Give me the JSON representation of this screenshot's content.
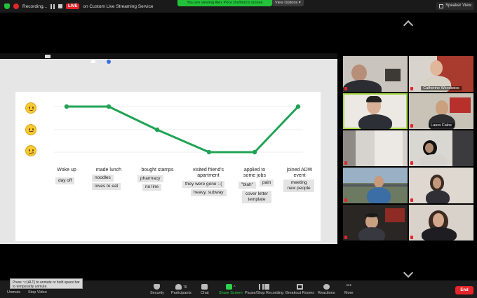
{
  "topbar": {
    "recording_label": "Recording...",
    "live_label": "LIVE",
    "stream_label": "on Custom Live Streaming Service",
    "viewing_label": "You are viewing Alex Price (he/him)'s screen",
    "view_options_label": "View Options",
    "speaker_view_label": "Speaker View"
  },
  "share_tabs": [
    "",
    "",
    "",
    ""
  ],
  "journey": {
    "stages": [
      {
        "label": "Woke up",
        "notes": [
          "day off"
        ]
      },
      {
        "label": "made lunch",
        "notes": [
          "noodles",
          "loves to eat"
        ]
      },
      {
        "label": "bought stamps",
        "notes": [
          "pharmacy",
          "no line"
        ]
      },
      {
        "label": "visited friend's apartment",
        "notes": [
          "they were gone :-(",
          "heavy, subway"
        ]
      },
      {
        "label": "applied to some jobs",
        "notes": [
          "\"blah\"",
          "pain",
          "cover letter template"
        ]
      },
      {
        "label": "joined ADW event",
        "notes": [
          "meeting new people"
        ]
      }
    ],
    "levels": [
      1,
      1,
      0,
      -1,
      -1,
      1
    ],
    "colors": {
      "line": "#1fa354",
      "grid": "#e6e6e6"
    }
  },
  "gallery": {
    "tiles": [
      {
        "name": ""
      },
      {
        "name": "Catherine Woodiwiss"
      },
      {
        "name": ""
      },
      {
        "name": "Laura Calos"
      },
      {
        "name": ""
      },
      {
        "name": ""
      },
      {
        "name": ""
      },
      {
        "name": ""
      },
      {
        "name": ""
      },
      {
        "name": ""
      }
    ]
  },
  "toolbar": {
    "unmute": "Unmute",
    "stop_video": "Stop Video",
    "security": "Security",
    "participants": "Participants",
    "participants_count": "76",
    "chat": "Chat",
    "share_screen": "Share Screen",
    "pause_recording": "Pause/Stop Recording",
    "breakout_rooms": "Breakout Rooms",
    "reactions": "Reactions",
    "more": "More",
    "end": "End",
    "tooltip": "Press ⌥(ALT) to unmute or hold space bar to temporarily unmute."
  }
}
